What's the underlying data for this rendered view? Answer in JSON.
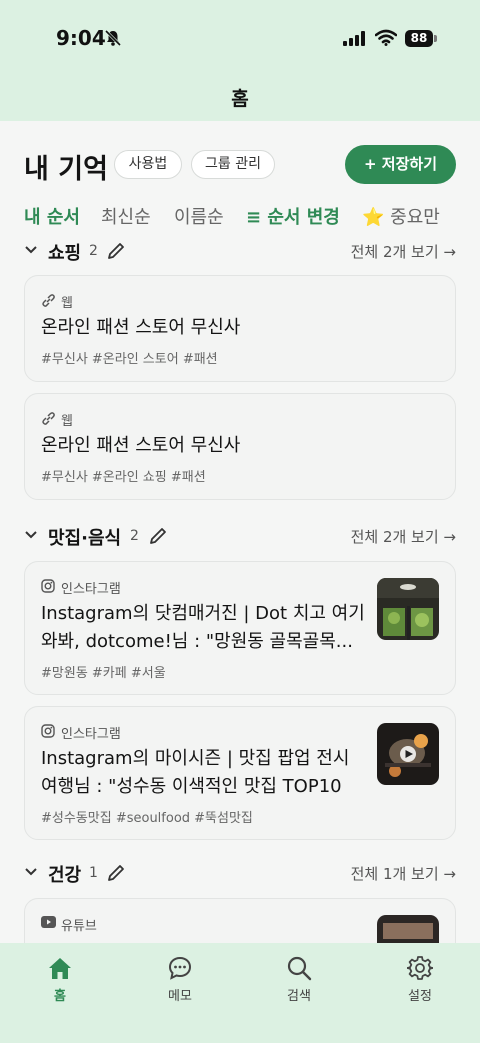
{
  "status_bar": {
    "time": "9:04",
    "battery": "88"
  },
  "nav": {
    "title": "홈"
  },
  "header": {
    "title": "내 기억",
    "usage_button": "사용법",
    "group_manage_button": "그룹 관리",
    "save_button": "+ 저장하기"
  },
  "sort_tabs": {
    "my_order": "내 순서",
    "latest": "최신순",
    "name": "이름순",
    "change_order": "≡ 순서 변경",
    "important": "⭐ 중요만"
  },
  "groups": [
    {
      "name": "쇼핑",
      "count": "2",
      "view_all": "전체 2개 보기 →",
      "items": [
        {
          "source": "웹",
          "title": "온라인 패션 스토어 무신사",
          "tags": "#무신사 #온라인 스토어 #패션"
        },
        {
          "source": "웹",
          "title": "온라인 패션 스토어 무신사",
          "tags": "#무신사 #온라인 쇼핑 #패션"
        }
      ]
    },
    {
      "name": "맛집·음식",
      "count": "2",
      "view_all": "전체 2개 보기 →",
      "items": [
        {
          "source": "인스타그램",
          "title_line1": "Instagram의 닷컴매거진 | Dot 치고 여기",
          "title_line2": "와봐, dotcome!님 : \"망원동 골목골목...",
          "tags": "#망원동 #카페 #서울"
        },
        {
          "source": "인스타그램",
          "title_line1": "Instagram의 마이시즌 | 맛집 팝업 전시",
          "title_line2": "여행님 : \"성수동 이색적인 맛집 TOP10",
          "tags": "#성수동맛집 #seoulfood #뚝섬맛집"
        }
      ]
    },
    {
      "name": "건강",
      "count": "1",
      "view_all": "전체 1개 보기 →",
      "items": [
        {
          "source": "유튜브"
        }
      ]
    }
  ],
  "tabbar": [
    {
      "label": "홈",
      "icon": "home-icon",
      "active": true
    },
    {
      "label": "메모",
      "icon": "chat-bubble-icon"
    },
    {
      "label": "검색",
      "icon": "search-icon"
    },
    {
      "label": "설정",
      "icon": "gear-icon"
    }
  ],
  "colors": {
    "accent": "#2f8a55",
    "header_bg": "#dcf1e2",
    "page_bg": "#f5f6f5"
  }
}
